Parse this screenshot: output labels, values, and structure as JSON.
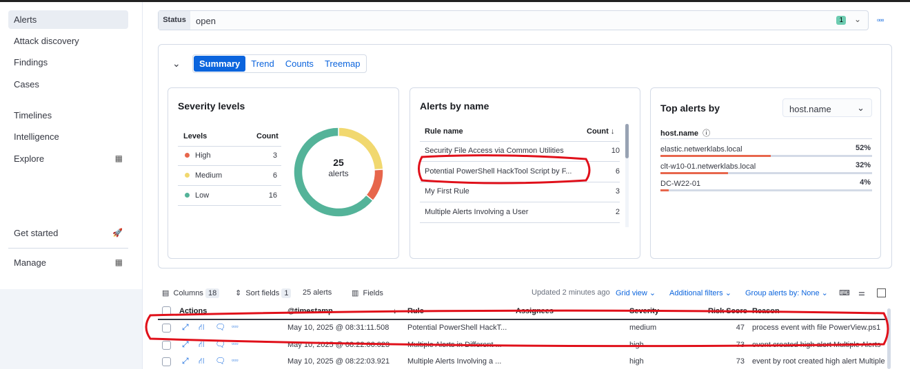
{
  "sidebar": {
    "items": [
      {
        "label": "Alerts"
      },
      {
        "label": "Attack discovery"
      },
      {
        "label": "Findings"
      },
      {
        "label": "Cases"
      },
      {
        "label": "Timelines"
      },
      {
        "label": "Intelligence"
      },
      {
        "label": "Explore"
      },
      {
        "label": "Get started"
      },
      {
        "label": "Manage"
      }
    ]
  },
  "status": {
    "label": "Status",
    "value": "open",
    "count": "1"
  },
  "tabs": [
    "Summary",
    "Trend",
    "Counts",
    "Treemap"
  ],
  "severity": {
    "title": "Severity levels",
    "col_levels": "Levels",
    "col_count": "Count",
    "rows": [
      {
        "label": "High",
        "count": "3",
        "value": 3,
        "color": "#e7664c"
      },
      {
        "label": "Medium",
        "count": "6",
        "value": 6,
        "color": "#f1d86f"
      },
      {
        "label": "Low",
        "count": "16",
        "value": 16,
        "color": "#54b399"
      }
    ],
    "total": "25",
    "total_label": "alerts"
  },
  "alerts_by_name": {
    "title": "Alerts by name",
    "col_rule": "Rule name",
    "col_count": "Count",
    "rows": [
      {
        "name": "Security File Access via Common Utilities",
        "count": "10"
      },
      {
        "name": "Potential PowerShell HackTool Script by F...",
        "count": "6"
      },
      {
        "name": "My First Rule",
        "count": "3"
      },
      {
        "name": "Multiple Alerts Involving a User",
        "count": "2"
      }
    ]
  },
  "top_alerts": {
    "title": "Top alerts by",
    "select": "host.name",
    "field": "host.name",
    "rows": [
      {
        "name": "elastic.netwerklabs.local",
        "pct": "52%",
        "value": 52
      },
      {
        "name": "clt-w10-01.netwerklabs.local",
        "pct": "32%",
        "value": 32
      },
      {
        "name": "DC-W22-01",
        "pct": "4%",
        "value": 4
      }
    ]
  },
  "toolbar": {
    "columns": "Columns",
    "columns_count": "18",
    "sort": "Sort fields",
    "sort_count": "1",
    "alerts": "25 alerts",
    "fields": "Fields",
    "updated": "Updated 2 minutes ago",
    "grid_view": "Grid view",
    "additional_filters": "Additional filters",
    "group_by": "Group alerts by: None"
  },
  "table": {
    "headers": [
      "Actions",
      "@timestamp",
      "Rule",
      "Assignees",
      "Severity",
      "Risk Score",
      "Reason"
    ],
    "rows": [
      {
        "timestamp": "May 10, 2025 @ 08:31:11.508",
        "rule": "Potential PowerShell HackT...",
        "severity": "medium",
        "risk": "47",
        "reason": "process event with file PowerView.ps1"
      },
      {
        "timestamp": "May 10, 2025 @ 08:22:06.023",
        "rule": "Multiple Alerts in Different ...",
        "severity": "high",
        "risk": "73",
        "reason": "event created high alert Multiple Alerts"
      },
      {
        "timestamp": "May 10, 2025 @ 08:22:03.921",
        "rule": "Multiple Alerts Involving a ...",
        "severity": "high",
        "risk": "73",
        "reason": "event by root created high alert Multiple"
      }
    ]
  }
}
